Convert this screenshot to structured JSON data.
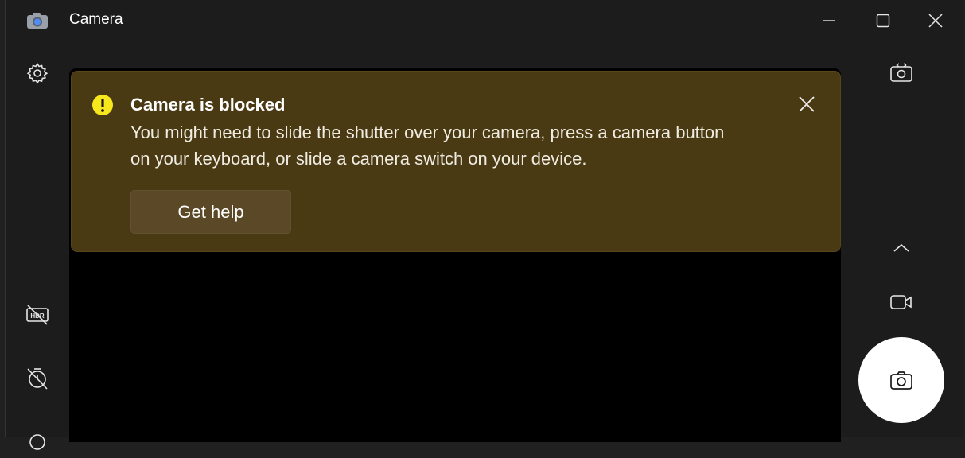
{
  "window": {
    "title": "Camera",
    "app_icon": "camera-app-icon",
    "controls": [
      "minimize-icon",
      "maximize-icon",
      "close-icon"
    ]
  },
  "left_toolbar": [
    {
      "icon": "gear-icon",
      "label": "Settings"
    },
    {
      "icon": "hdr-off-icon",
      "label": "HDR off"
    },
    {
      "icon": "timer-off-icon",
      "label": "Timer off"
    }
  ],
  "right_toolbar": [
    {
      "icon": "switch-camera-icon",
      "label": "Change camera"
    },
    {
      "icon": "chevron-up-icon",
      "label": "Expand"
    },
    {
      "icon": "video-icon",
      "label": "Video mode"
    }
  ],
  "banner": {
    "title": "Camera is blocked",
    "message": "You might need to slide the shutter over your camera, press a camera button on your keyboard, or slide a camera switch on your device.",
    "help_label": "Get help",
    "icon": "warning-icon"
  },
  "shutter": {
    "icon": "camera-icon"
  },
  "colors": {
    "window_bg": "#1c1c1c",
    "banner_bg": "#4a3a14",
    "warning_accent": "#f8e71c",
    "shutter_bg": "#ffffff"
  }
}
